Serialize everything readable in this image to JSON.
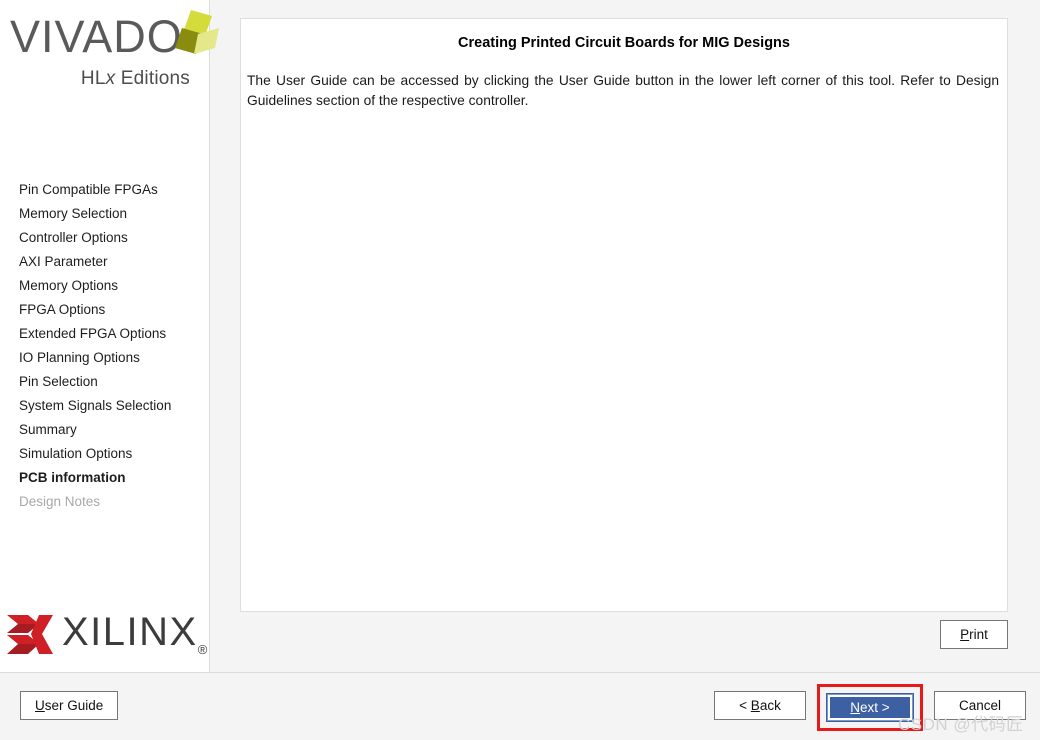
{
  "window": {
    "product_name": "VIVADO",
    "product_registered_mark": "®",
    "product_edition_prefix": "HL",
    "product_edition_italic": "x",
    "product_edition_suffix": " Editions",
    "vendor_name": "XILINX",
    "vendor_registered_mark": "®"
  },
  "sidebar": {
    "items": [
      {
        "label": "Pin Compatible FPGAs",
        "state": "normal"
      },
      {
        "label": "Memory Selection",
        "state": "normal"
      },
      {
        "label": "Controller Options",
        "state": "normal"
      },
      {
        "label": "AXI Parameter",
        "state": "normal"
      },
      {
        "label": "Memory Options",
        "state": "normal"
      },
      {
        "label": "FPGA Options",
        "state": "normal"
      },
      {
        "label": "Extended FPGA Options",
        "state": "normal"
      },
      {
        "label": "IO Planning Options",
        "state": "normal"
      },
      {
        "label": "Pin Selection",
        "state": "normal"
      },
      {
        "label": "System Signals Selection",
        "state": "normal"
      },
      {
        "label": "Summary",
        "state": "normal"
      },
      {
        "label": "Simulation Options",
        "state": "normal"
      },
      {
        "label": "PCB information",
        "state": "current"
      },
      {
        "label": "Design Notes",
        "state": "disabled"
      }
    ]
  },
  "main": {
    "title": "Creating Printed Circuit Boards for MIG Designs",
    "body": "The User Guide can be accessed by clicking the User Guide button in the lower left corner of this tool. Refer to Design Guidelines section of the respective controller."
  },
  "buttons": {
    "print": {
      "prefix": "",
      "mnemonic": "P",
      "suffix": "rint"
    },
    "user_guide": {
      "prefix": "",
      "mnemonic": "U",
      "suffix": "ser Guide"
    },
    "back": {
      "prefix": "< ",
      "mnemonic": "B",
      "suffix": "ack"
    },
    "next": {
      "prefix": "",
      "mnemonic": "N",
      "suffix": "ext >"
    },
    "cancel": {
      "prefix": "",
      "mnemonic": "",
      "suffix": "Cancel"
    }
  },
  "annotation": {
    "target": "next-button",
    "color": "#e8191b"
  },
  "watermark": {
    "text": "CSDN @代码匠"
  },
  "colors": {
    "default_button_blue": "#3c60a1",
    "annotation_red": "#e8191b",
    "vivado_gray": "#5a5a5a",
    "xilinx_red": "#cf2026",
    "xilinx_dark_red": "#a61c22",
    "vivado_mark_olive": "#8a8c10",
    "vivado_mark_yellow": "#d4dc3c",
    "vivado_mark_pale": "#e4e88a",
    "panel_background": "#ffffff",
    "window_background": "#f4f4f4"
  }
}
